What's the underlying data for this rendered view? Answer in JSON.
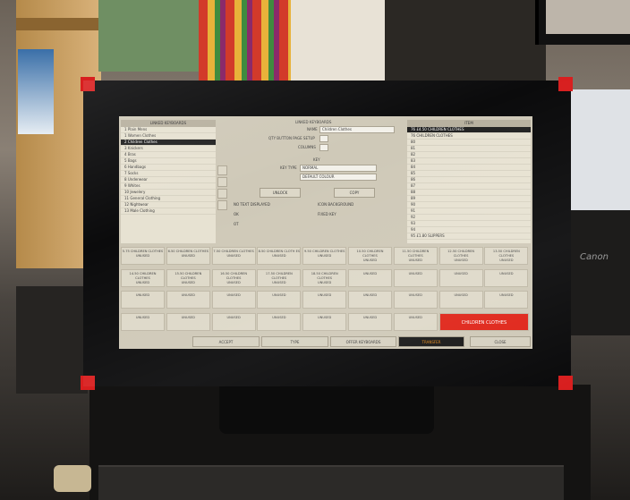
{
  "photo": {
    "description_brand": "Canon"
  },
  "pos_screen": {
    "left_panel": {
      "header": "LINKED KEYBOARDS",
      "items": [
        "1  Plain Mens",
        "1  Women Clothes",
        "2  Children Clothes",
        "3  Knickers",
        "4  Bras",
        "5  Bags",
        "6  Handbags",
        "7  Socks",
        "8  Underwear",
        "9  Whites",
        "10  Jewelery",
        "11  General Clothing",
        "12  Nightwear",
        "13  Male Clothing"
      ],
      "selected_index": 2
    },
    "center": {
      "title": "LINKED KEYBOARDS",
      "name_label": "NAME",
      "name_value": "Children Clothes",
      "qty_label": "QTY BUTTON PAGE SETUP",
      "columns_label": "COLUMNS",
      "key_section": "KEY",
      "key_type_label": "KEY TYPE",
      "key_type_value": "NORMAL",
      "colour_value": "DEFAULT COLOUR",
      "btn_unlock": "UNLOCK",
      "btn_copy": "COPY",
      "chk_no_text": "NO TEXT DISPLAYED",
      "chk_icon_bg": "ICON BACKGROUND",
      "chk_1": "OK",
      "chk_fixed": "FIXED KEY",
      "chk_3": "OT"
    },
    "right_panel": {
      "header": "ITEM",
      "items": [
        "76  £4.50 CHILDREN CLOTHES",
        "76  CHILDREN CLOTHES",
        "80",
        "81",
        "82",
        "83",
        "84",
        "85",
        "86",
        "87",
        "88",
        "89",
        "90",
        "91",
        "92",
        "93",
        "94",
        "95  £1.80 SLIPPERS"
      ],
      "selected_index": 0
    },
    "tiles_row1": [
      "5.75 CHILDREN CLOTHES",
      "6.50 CHILDREN CLOTHES",
      "7.50 CHILDREN CLOTHES",
      "8.50 CHILDREN CLOTH ES",
      "9.50 CHILDREN CLOTHES",
      "10.50 CHILDREN CLOTHES",
      "11.50 CHILDREN CLOTHES",
      "12.50 CHILDREN CLOTHES",
      "13.50 CHILDREN CLOTHES"
    ],
    "tiles_row2": [
      "14.50 CHILDREN CLOTHES",
      "15.50 CHILDREN CLOTHES",
      "16.50 CHILDREN CLOTHES",
      "17.50 CHILDREN CLOTHES",
      "18.50 CHILDREN CLOTHES",
      "",
      "",
      "",
      ""
    ],
    "tile_sub": "UNUSED",
    "red_tile": "CHILDREN CLOTHES",
    "bottom_bar": [
      "ACCEPT",
      "TYPE",
      "OFFER KEYBOARDS",
      "TRANSFER",
      "CLOSE"
    ],
    "active_bottom": 3
  }
}
